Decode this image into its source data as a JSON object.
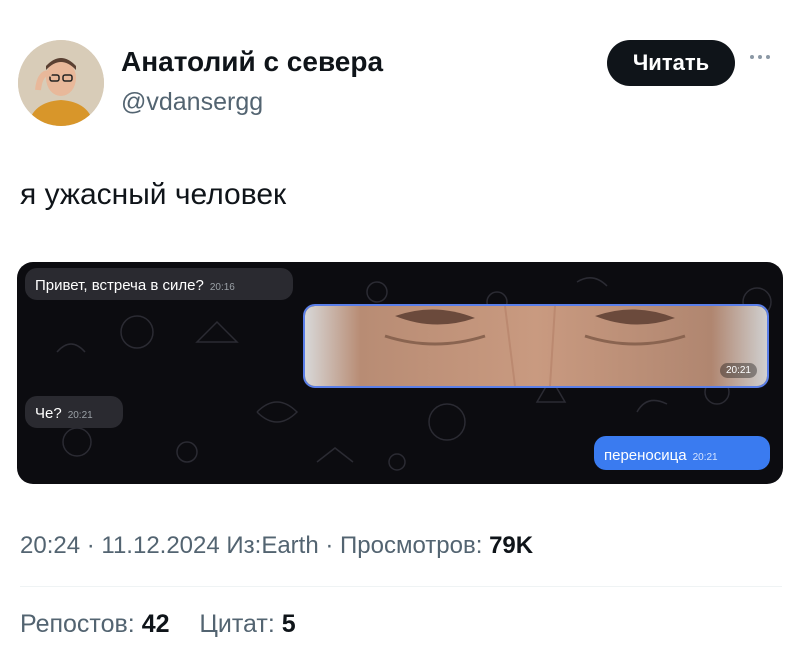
{
  "user": {
    "display_name": "Анатолий с севера",
    "handle": "@vdansergg",
    "follow_label": "Читать"
  },
  "tweet": {
    "text": "я ужасный человек"
  },
  "chat": {
    "messages": [
      {
        "text": "Привет, встреча в силе?",
        "time": "20:16",
        "direction": "in"
      },
      {
        "photo_caption_time": "20:21",
        "direction": "out"
      },
      {
        "text": "Че?",
        "time": "20:21",
        "direction": "in"
      },
      {
        "text": "переносица",
        "time": "20:21",
        "direction": "out"
      }
    ]
  },
  "meta": {
    "time": "20:24",
    "date": "11.12.2024",
    "source": "Из:Earth",
    "views_label": "Просмотров:",
    "views": "79K"
  },
  "stats": {
    "reposts_label": "Репостов:",
    "reposts": "42",
    "quotes_label": "Цитат:",
    "quotes": "5"
  },
  "colors": {
    "accent": "#3a7bf0",
    "follow_bg": "#0f1419",
    "muted": "#536471"
  }
}
